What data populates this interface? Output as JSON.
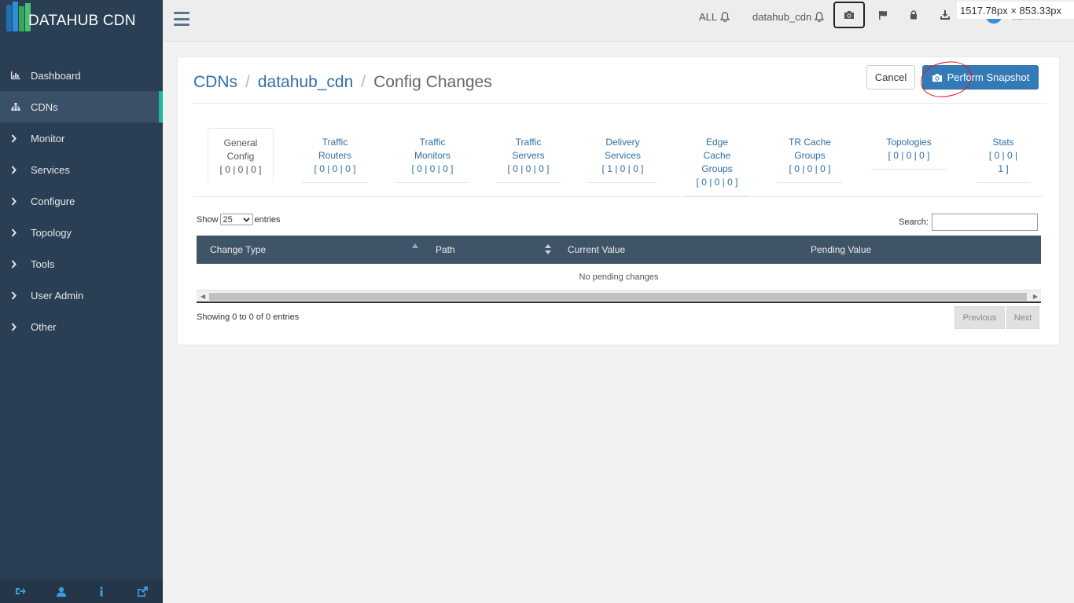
{
  "brand": {
    "title": "DATAHUB CDN"
  },
  "sidebar": {
    "items": [
      {
        "label": "Dashboard",
        "icon": "bar-chart-icon"
      },
      {
        "label": "CDNs",
        "icon": "sitemap-icon"
      },
      {
        "label": "Monitor",
        "icon": "chevron-right-icon"
      },
      {
        "label": "Services",
        "icon": "chevron-right-icon"
      },
      {
        "label": "Configure",
        "icon": "chevron-right-icon"
      },
      {
        "label": "Topology",
        "icon": "chevron-right-icon"
      },
      {
        "label": "Tools",
        "icon": "chevron-right-icon"
      },
      {
        "label": "User Admin",
        "icon": "chevron-right-icon"
      },
      {
        "label": "Other",
        "icon": "chevron-right-icon"
      }
    ],
    "active_index": 1,
    "footer_icons": [
      "logout-icon",
      "user-icon",
      "info-icon",
      "external-link-icon"
    ]
  },
  "topbar": {
    "all_label": "ALL",
    "cdn_label": "datahub_cdn",
    "user_label": "admin",
    "dimensions_overlay": "1517.78px × 853.33px",
    "icons": [
      "bell-icon",
      "camera-icon",
      "flag-icon",
      "lock-icon",
      "download-icon"
    ]
  },
  "breadcrumb": {
    "cdns": "CDNs",
    "sep1": "/",
    "cdn": "datahub_cdn",
    "sep2": "/",
    "current": "Config Changes"
  },
  "buttons": {
    "cancel": "Cancel",
    "snapshot": "Perform Snapshot"
  },
  "tabs": [
    {
      "lines": [
        "General",
        "Config",
        "[ 0 | 0 | 0 ]"
      ]
    },
    {
      "lines": [
        "Traffic",
        "Routers",
        "[ 0 | 0 | 0 ]"
      ]
    },
    {
      "lines": [
        "Traffic",
        "Monitors",
        "[ 0 | 0 | 0 ]"
      ]
    },
    {
      "lines": [
        "Traffic",
        "Servers",
        "[ 0 | 0 | 0 ]"
      ]
    },
    {
      "lines": [
        "Delivery",
        "Services",
        "[ 1 | 0 | 0 ]"
      ]
    },
    {
      "lines": [
        "Edge",
        "Cache",
        "Groups",
        "[ 0 | 0 | 0 ]"
      ]
    },
    {
      "lines": [
        "TR Cache",
        "Groups",
        "[ 0 | 0 | 0 ]"
      ]
    },
    {
      "lines": [
        "Topologies",
        "[ 0 | 0 | 0 ]"
      ]
    },
    {
      "lines": [
        "Stats",
        "[ 0 | 0 |",
        "1 ]"
      ]
    }
  ],
  "table": {
    "show_label": "Show",
    "page_size": "25",
    "entries_label": "entries",
    "search_label": "Search:",
    "columns": [
      "Change Type",
      "Path",
      "Current Value",
      "Pending Value"
    ],
    "empty_message": "No pending changes",
    "info": "Showing 0 to 0 of 0 entries",
    "prev": "Previous",
    "next": "Next"
  }
}
